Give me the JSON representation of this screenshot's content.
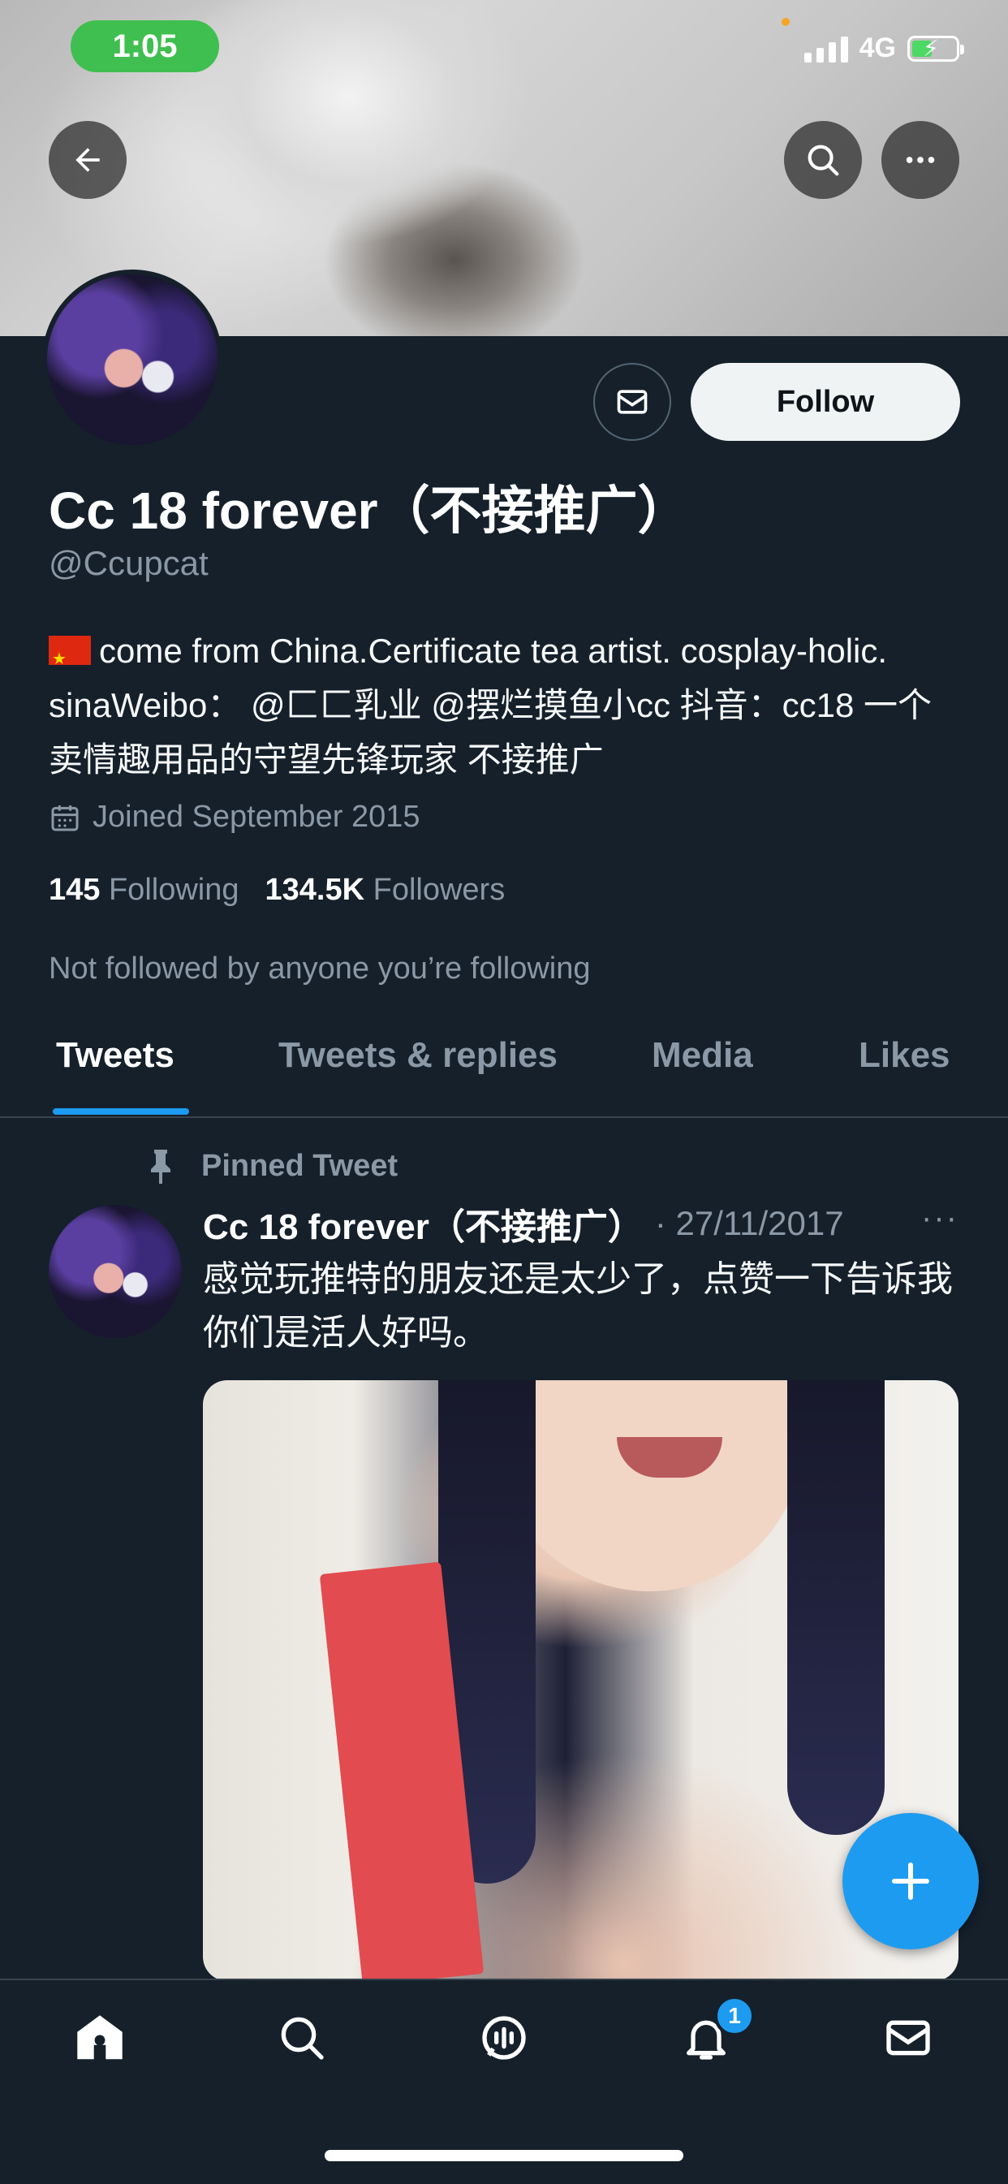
{
  "status_bar": {
    "time": "1:05",
    "network": "4G"
  },
  "profile": {
    "display_name": "Cc 18 forever（不接推广）",
    "handle": "@Ccupcat",
    "bio": "come from China.Certificate tea artist. cosplay-holic. sinaWeibo： @匚匚乳业 @摆烂摸鱼小cc 抖音：cc18 一个卖情趣用品的守望先锋玩家 不接推广",
    "joined": "Joined September 2015",
    "following_count": "145",
    "following_label": "Following",
    "followers_count": "134.5K",
    "followers_label": "Followers",
    "not_followed": "Not followed by anyone you’re following",
    "follow_button": "Follow"
  },
  "tabs": [
    {
      "label": "Tweets",
      "active": true
    },
    {
      "label": "Tweets & replies",
      "active": false
    },
    {
      "label": "Media",
      "active": false
    },
    {
      "label": "Likes",
      "active": false
    }
  ],
  "pinned_tweet": {
    "pinned_label": "Pinned Tweet",
    "author": "Cc 18 forever（不接推广）",
    "date": "· 27/11/2017",
    "more": "···",
    "text": "感觉玩推特的朋友还是太少了，点赞一下告诉我你们是活人好吗。"
  },
  "bottom_nav": {
    "items": [
      "home-icon",
      "search-icon",
      "spaces-icon",
      "notifications-icon",
      "messages-icon"
    ],
    "notification_badge": "1"
  },
  "colors": {
    "accent": "#1d9bf0",
    "background": "#15202b",
    "muted": "#8b98a5"
  }
}
